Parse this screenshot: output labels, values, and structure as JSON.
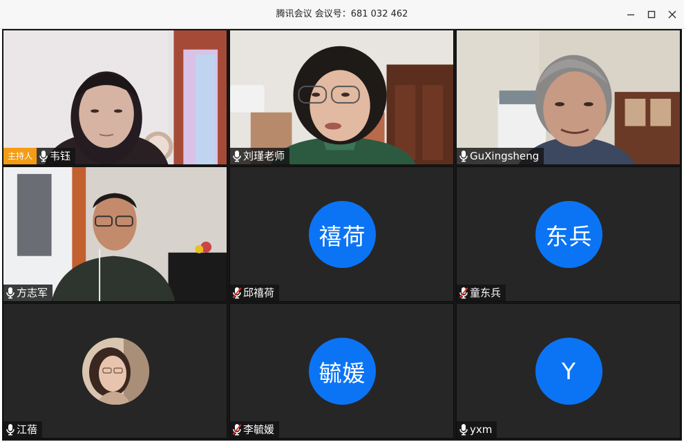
{
  "window": {
    "title": "腾讯会议 会议号：681 032 462",
    "controls": [
      "minimize-icon",
      "maximize-icon",
      "close-icon"
    ]
  },
  "host_badge": "主持人",
  "participants": [
    {
      "name": "韦钰",
      "video": true,
      "mic": "on"
    },
    {
      "name": "刘瑾老师",
      "video": true,
      "mic": "on"
    },
    {
      "name": "GuXingsheng",
      "video": true,
      "mic": "on"
    },
    {
      "name": "方志军",
      "video": true,
      "mic": "on"
    },
    {
      "name": "邱禧荷",
      "video": false,
      "avatar_text": "禧荷",
      "mic": "muted"
    },
    {
      "name": "童东兵",
      "video": false,
      "avatar_text": "东兵",
      "mic": "muted"
    },
    {
      "name": "江蓓",
      "video": false,
      "avatar_photo": true,
      "mic": "on"
    },
    {
      "name": "李毓媛",
      "video": false,
      "avatar_text": "毓媛",
      "mic": "muted"
    },
    {
      "name": "yxm",
      "video": false,
      "avatar_text": "Y",
      "mic": "on"
    }
  ],
  "colors": {
    "avatar": "#0b74f5",
    "host_badge": "#f49c16",
    "tile_bg": "#262626",
    "muted_mic": "#e5322d"
  }
}
